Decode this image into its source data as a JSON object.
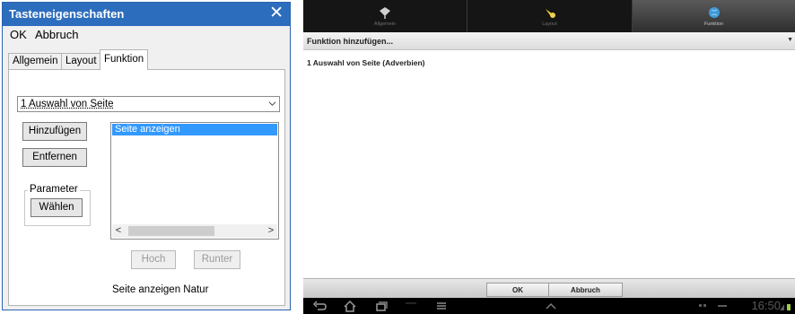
{
  "dialog": {
    "title": "Tasteneigenschaften",
    "close_glyph": "✕",
    "menu": {
      "ok": "OK",
      "cancel": "Abbruch"
    },
    "tabs": [
      {
        "label": "Allgemein",
        "active": false
      },
      {
        "label": "Layout",
        "active": false
      },
      {
        "label": "Funktion",
        "active": true
      }
    ],
    "function_select": {
      "value": "1 Auswahl von Seite"
    },
    "buttons": {
      "add": "Hinzufügen",
      "remove": "Entfernen",
      "choose": "Wählen",
      "up": "Hoch",
      "down": "Runter"
    },
    "parameter_group": "Parameter",
    "list": {
      "items": [
        "Seite anzeigen"
      ],
      "selected_index": 0
    },
    "status_text": "Seite anzeigen Natur",
    "colors": {
      "titlebar": "#2d6dbd",
      "selection": "#3399ff"
    }
  },
  "android": {
    "tabs": [
      {
        "label": "Allgemein",
        "icon": "tag-icon",
        "active": false
      },
      {
        "label": "Layout",
        "icon": "brush-icon",
        "active": false
      },
      {
        "label": "Funktion",
        "icon": "globe-icon",
        "active": true
      }
    ],
    "add_function": "Funktion hinzufügen...",
    "items": [
      "1 Auswahl von Seite (Adverbien)"
    ],
    "bottom": {
      "ok": "OK",
      "cancel": "Abbruch"
    },
    "clock": "16:50"
  }
}
